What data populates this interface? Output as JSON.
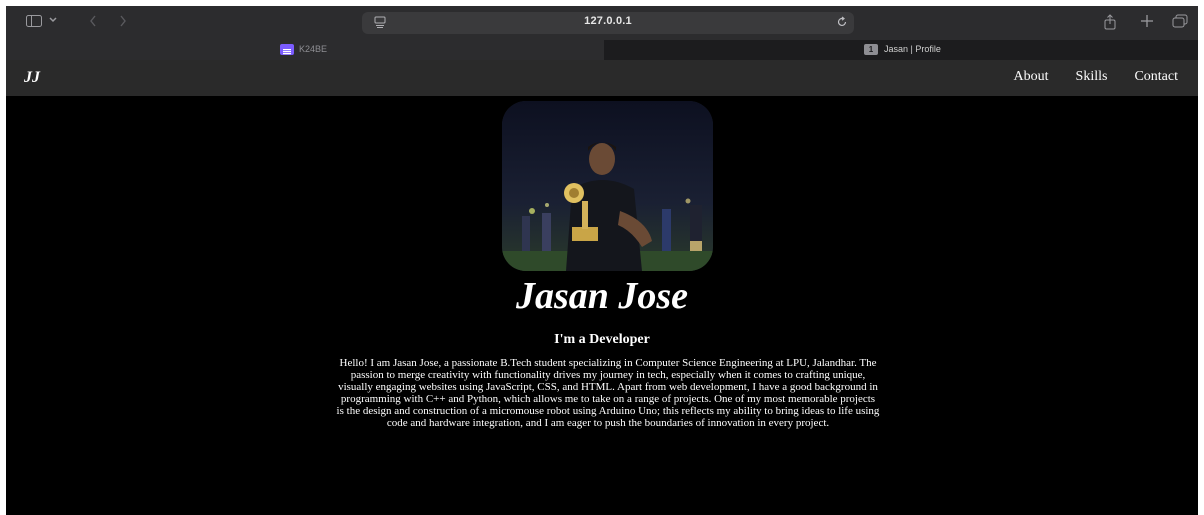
{
  "browser": {
    "url": "127.0.0.1",
    "tabs": [
      {
        "label": "K24BE",
        "favicon_color": "#7b5cff",
        "active": true
      },
      {
        "label": "Jasan | Profile",
        "favicon_text": "1",
        "active": false
      }
    ]
  },
  "site": {
    "logo": "JJ",
    "nav": {
      "about": "About",
      "skills": "Skills",
      "contact": "Contact"
    },
    "hero": {
      "photo_alt": "Jasan Jose holding a trophy",
      "name": "Jasan Jose",
      "tagline": "I'm a Developer",
      "bio": "Hello! I am Jasan Jose, a passionate B.Tech student specializing in Computer Science Engineering at LPU, Jalandhar. The passion to merge creativity with functionality drives my journey in tech, especially when it comes to crafting unique, visually engaging websites using JavaScript, CSS, and HTML. Apart from web development, I have a good background in programming with C++ and Python, which allows me to take on a range of projects. One of my most memorable projects is the design and construction of a micromouse robot using Arduino Uno; this reflects my ability to bring ideas to life using code and hardware integration, and I am eager to push the boundaries of innovation in every project."
    }
  },
  "colors": {
    "page_bg": "#000000",
    "nav_bg": "#2a2a2a",
    "toolbar_bg": "#2c2c2e",
    "text": "#ffffff"
  }
}
